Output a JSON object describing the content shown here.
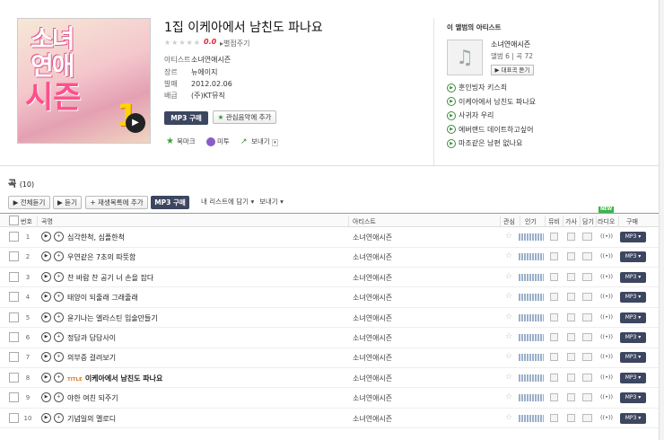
{
  "album": {
    "title": "1집 이케아에서 남친도 파나요",
    "stars": "★★★★★",
    "score": "0.0",
    "rate_link": "▸별점주기",
    "info": [
      {
        "key": "아티스트",
        "value": "소녀연애시즌"
      },
      {
        "key": "장르",
        "value": "뉴에이지"
      },
      {
        "key": "발매",
        "value": "2012.02.06"
      },
      {
        "key": "배급",
        "value": "(주)KT뮤직"
      }
    ],
    "cover_text": [
      "소녀",
      "연애",
      "시즌",
      "1"
    ],
    "buy_mp3": "MP3 구매",
    "add_fav": "관심음악에 추가",
    "share": {
      "bookmark": "북마크",
      "me2day": "미투",
      "send": "보내기"
    }
  },
  "side": {
    "heading": "이 앨범의 아티스트",
    "artist_name": "소녀연애시즌",
    "meta": "앨범 6 | 곡 72",
    "rep_button": "대표곡 듣기",
    "songs": [
      "훈인빙자 키스죄",
      "이케아에서 남친도 파나요",
      "사귀자 우리",
      "에버랜드 데이트하고싶어",
      "마조같은 남편 없나요"
    ]
  },
  "section": {
    "title": "곡",
    "count": "(10)"
  },
  "toolbar": {
    "play_all": "▶ 전체듣기",
    "play": "▶ 듣기",
    "add_playlist": "+ 재생목록에 추가",
    "mp3_buy": "MP3 구매",
    "add_my_list": "내 리스트에 담기 ▾",
    "send": "보내기 ▾"
  },
  "table_headers": {
    "num": "번호",
    "song": "곡명",
    "artist": "아티스트",
    "fav": "관심",
    "pop": "인기",
    "video": "뮤비",
    "lyrics": "가사",
    "save": "담기",
    "radio": "라디오",
    "buy": "구매",
    "new_badge": "NEW"
  },
  "tracks": [
    {
      "num": "1",
      "title": "심각한척, 심플한척",
      "artist": "소녀연애시즌",
      "title_track": false
    },
    {
      "num": "2",
      "title": "우연같은 7초의 따뜻함",
      "artist": "소녀연애시즌",
      "title_track": false
    },
    {
      "num": "3",
      "title": "찬 바람 찬 공기 너 손을 잡다",
      "artist": "소녀연애시즌",
      "title_track": false
    },
    {
      "num": "4",
      "title": "태양이 되줄래 그래줄래",
      "artist": "소녀연애시즌",
      "title_track": false
    },
    {
      "num": "5",
      "title": "윤기나는 엘라스틴 입술만들기",
      "artist": "소녀연애시즌",
      "title_track": false
    },
    {
      "num": "6",
      "title": "정답과 답답사이",
      "artist": "소녀연애시즌",
      "title_track": false
    },
    {
      "num": "7",
      "title": "의부증 걸려보기",
      "artist": "소녀연애시즌",
      "title_track": false
    },
    {
      "num": "8",
      "title": "이케아에서 남친도 파나요",
      "artist": "소녀연애시즌",
      "title_track": true,
      "badge": "TITLE"
    },
    {
      "num": "9",
      "title": "야한 여친 되주기",
      "artist": "소녀연애시즌",
      "title_track": false
    },
    {
      "num": "10",
      "title": "기념일의 멜로디",
      "artist": "소녀연애시즌",
      "title_track": false
    }
  ],
  "row_labels": {
    "radio": "((•))",
    "mp3": "MP3 ▾"
  }
}
